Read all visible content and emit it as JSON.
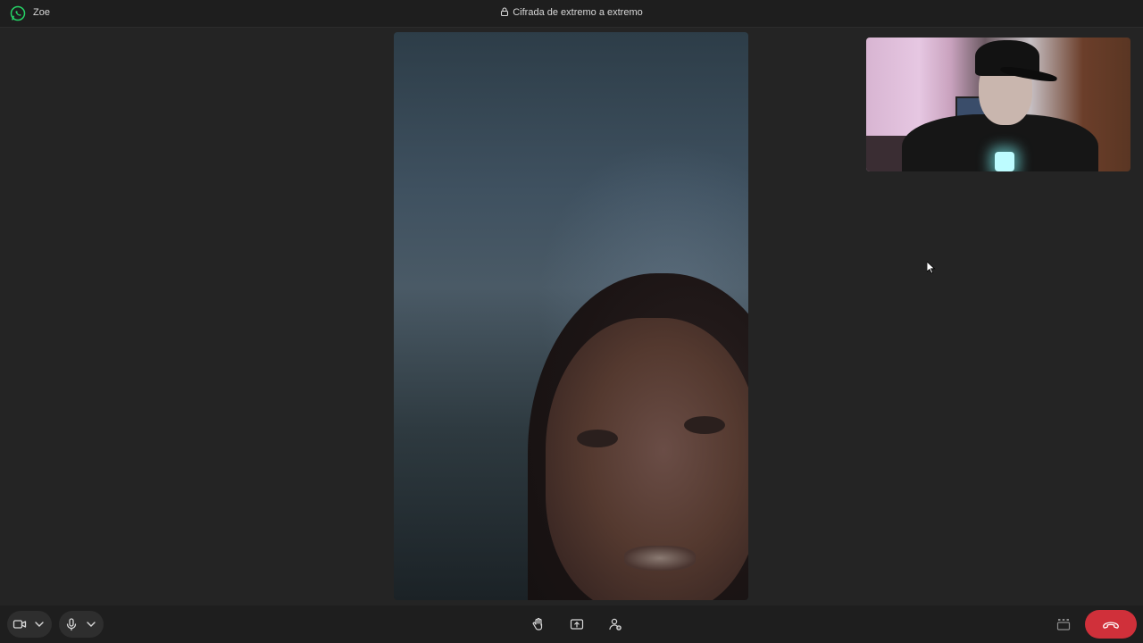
{
  "titlebar": {
    "contact_name": "Zoe",
    "encryption_text": "Cifrada de extremo a extremo"
  },
  "colors": {
    "brand_green": "#25D366",
    "end_call_red": "#d0303a"
  },
  "controls": {
    "left": [
      "camera-icon",
      "chevron-down-icon",
      "microphone-icon",
      "chevron-down-icon"
    ],
    "center": [
      "raise-hand-icon",
      "share-screen-icon",
      "add-participant-icon"
    ],
    "right": [
      "layout-icon",
      "end-call-icon"
    ]
  }
}
